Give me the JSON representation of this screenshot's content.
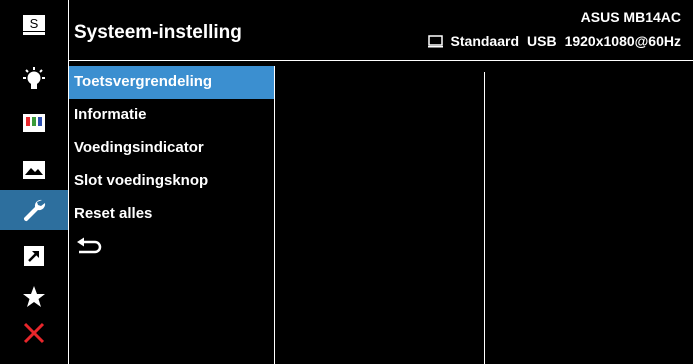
{
  "header": {
    "title": "Systeem-instelling",
    "model": "ASUS MB14AC",
    "status": {
      "mode": "Standaard",
      "input": "USB",
      "resolution": "1920x1080@60Hz",
      "icon": "monitor-icon"
    }
  },
  "sidebar": {
    "items": [
      {
        "name": "splendid-icon",
        "label": "S",
        "active": false
      },
      {
        "name": "blue-light-filter-icon",
        "active": false
      },
      {
        "name": "color-icon",
        "active": false
      },
      {
        "name": "image-icon",
        "active": false
      },
      {
        "name": "wrench-icon",
        "active": true
      },
      {
        "name": "shortcut-arrow-icon",
        "active": false
      },
      {
        "name": "star-icon",
        "active": false
      },
      {
        "name": "close-icon",
        "active": false
      }
    ]
  },
  "menu": {
    "items": [
      {
        "label": "Toetsvergrendeling",
        "selected": true
      },
      {
        "label": "Informatie",
        "selected": false
      },
      {
        "label": "Voedingsindicator",
        "selected": false
      },
      {
        "label": "Slot voedingsknop",
        "selected": false
      },
      {
        "label": "Reset alles",
        "selected": false
      }
    ],
    "back_icon": "return-arrow-icon"
  },
  "colors": {
    "background": "#000000",
    "active_rail": "#2d6f9e",
    "selected_item": "#3b8fd0",
    "close": "#e8262b",
    "text": "#ffffff"
  }
}
